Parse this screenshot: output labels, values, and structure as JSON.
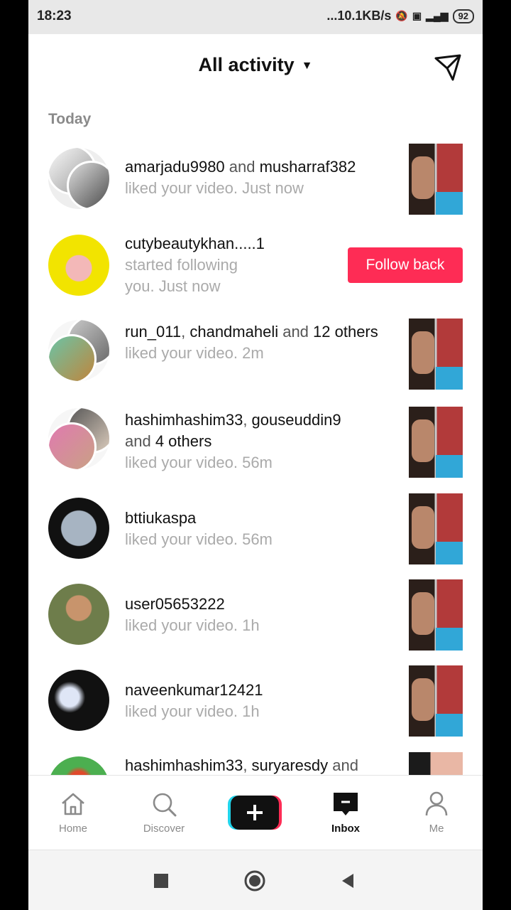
{
  "status_bar": {
    "time": "18:23",
    "network_speed": "...10.1KB/s",
    "icons": [
      "mute-icon",
      "volte-icon",
      "signal-4g-icon"
    ],
    "battery": "92"
  },
  "header": {
    "title": "All activity",
    "dropdown_icon": "caret-down-icon",
    "send_icon": "send-icon"
  },
  "section_label": "Today",
  "rows": [
    {
      "names": "amarjadu9980",
      "sep": " and ",
      "names2": "musharraf382",
      "rest": "",
      "action": "liked your video. Just now"
    },
    {
      "names": "cutybeautykhan.....1",
      "action": "started following you. Just now",
      "button": "Follow back"
    },
    {
      "names": "run_011",
      "sep": ", ",
      "names2": "chandmaheli",
      "mid": " and ",
      "count": "12 others",
      "action": "liked your video. 2m"
    },
    {
      "names": "hashimhashim33",
      "sep": ", ",
      "names2": "gouseuddin9",
      "mid": " and ",
      "count": "4 others",
      "action": "liked your video. 56m"
    },
    {
      "names": "bttiukaspa",
      "action": "liked your video. 56m"
    },
    {
      "names": "user05653222",
      "action": "liked your video. 1h"
    },
    {
      "names": "naveenkumar12421",
      "action": "liked your video. 1h"
    },
    {
      "names": "hashimhashim33",
      "sep": ", ",
      "names2": "suryaresdy",
      "mid": " and"
    }
  ],
  "nav": {
    "home": "Home",
    "discover": "Discover",
    "create": "create-icon",
    "inbox": "Inbox",
    "me": "Me"
  },
  "colors": {
    "accent": "#fe2c55",
    "muted_text": "#aaaaaa",
    "background": "#ffffff"
  }
}
